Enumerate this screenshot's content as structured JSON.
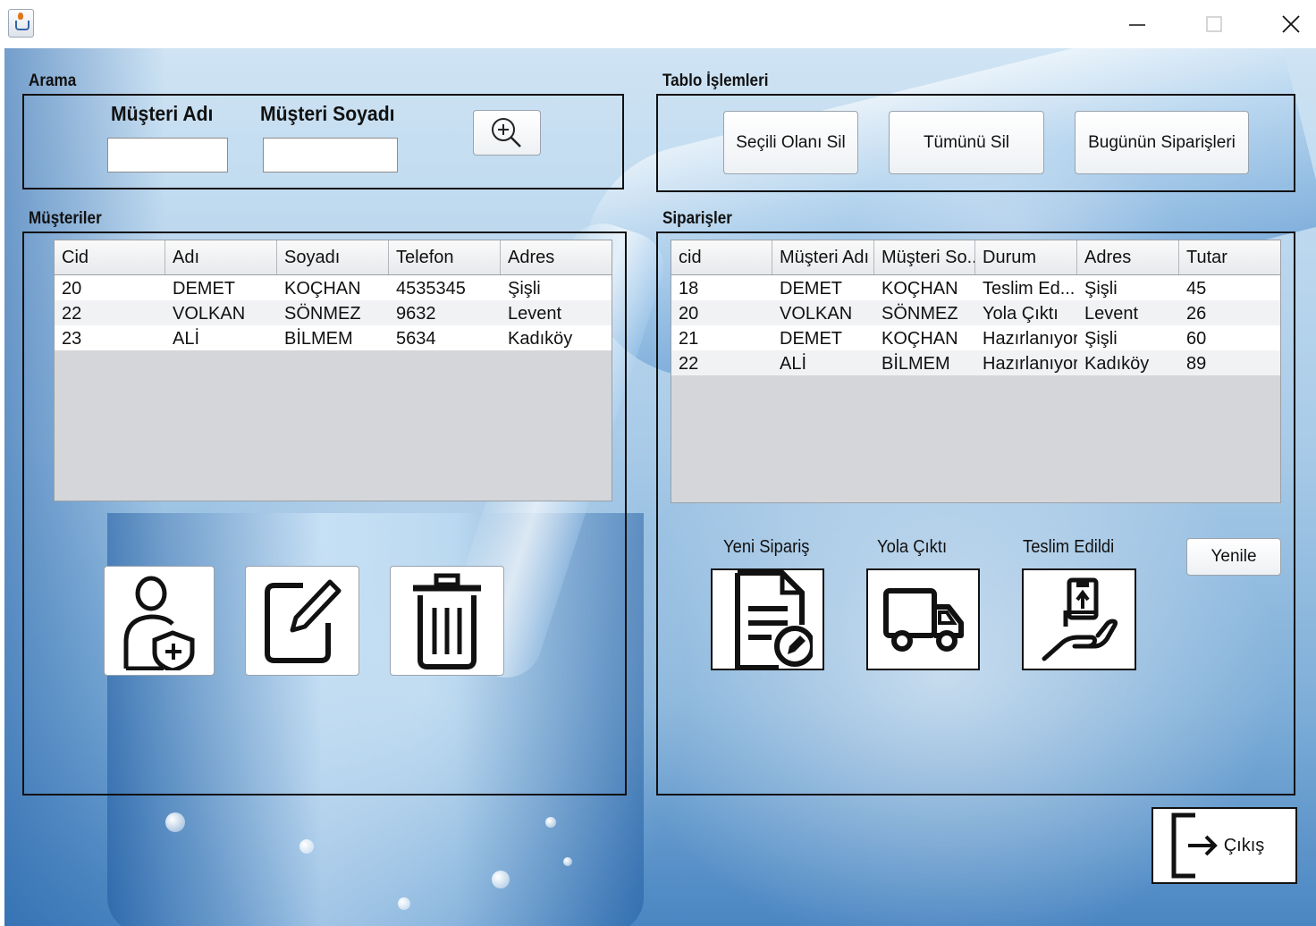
{
  "window": {
    "icon": "java-cup-icon",
    "controls": {
      "minimize": "minimize-icon",
      "maximize": "maximize-icon",
      "close": "close-icon"
    }
  },
  "search": {
    "section_title": "Arama",
    "first_name_label": "Müşteri Adı",
    "first_name_value": "",
    "last_name_label": "Müşteri Soyadı",
    "last_name_value": "",
    "search_icon": "zoom-in-icon"
  },
  "table_ops": {
    "section_title": "Tablo İşlemleri",
    "delete_selected": "Seçili Olanı Sil",
    "delete_all": "Tümünü Sil",
    "todays_orders": "Bugünün Siparişleri"
  },
  "customers": {
    "section_title": "Müşteriler",
    "columns": [
      "Cid",
      "Adı",
      "Soyadı",
      "Telefon",
      "Adres"
    ],
    "rows": [
      [
        "20",
        "DEMET",
        "KOÇHAN",
        "4535345",
        "Şişli"
      ],
      [
        "22",
        "VOLKAN",
        "SÖNMEZ",
        "9632",
        "Levent"
      ],
      [
        "23",
        "ALİ",
        "BİLMEM",
        "5634",
        "Kadıköy"
      ]
    ],
    "actions": {
      "add": "add-user-shield-icon",
      "edit": "edit-icon",
      "delete": "trash-icon"
    }
  },
  "orders": {
    "section_title": "Siparişler",
    "columns": [
      "cid",
      "Müşteri Adı",
      "Müşteri So...",
      "Durum",
      "Adres",
      "Tutar"
    ],
    "rows": [
      [
        "18",
        "DEMET",
        "KOÇHAN",
        "Teslim Ed...",
        "Şişli",
        "45"
      ],
      [
        "20",
        "VOLKAN",
        "SÖNMEZ",
        "Yola Çıktı",
        "Levent",
        "26"
      ],
      [
        "21",
        "DEMET",
        "KOÇHAN",
        "Hazırlanıyor",
        "Şişli",
        "60"
      ],
      [
        "22",
        "ALİ",
        "BİLMEM",
        "Hazırlanıyor",
        "Kadıköy",
        "89"
      ]
    ],
    "new_order_label": "Yeni Sipariş",
    "on_the_way_label": "Yola Çıktı",
    "delivered_label": "Teslim Edildi",
    "refresh": "Yenile",
    "icons": {
      "new_order": "document-edit-icon",
      "on_the_way": "truck-icon",
      "delivered": "hand-package-icon"
    }
  },
  "exit": {
    "label": "Çıkış",
    "icon": "exit-door-icon"
  }
}
